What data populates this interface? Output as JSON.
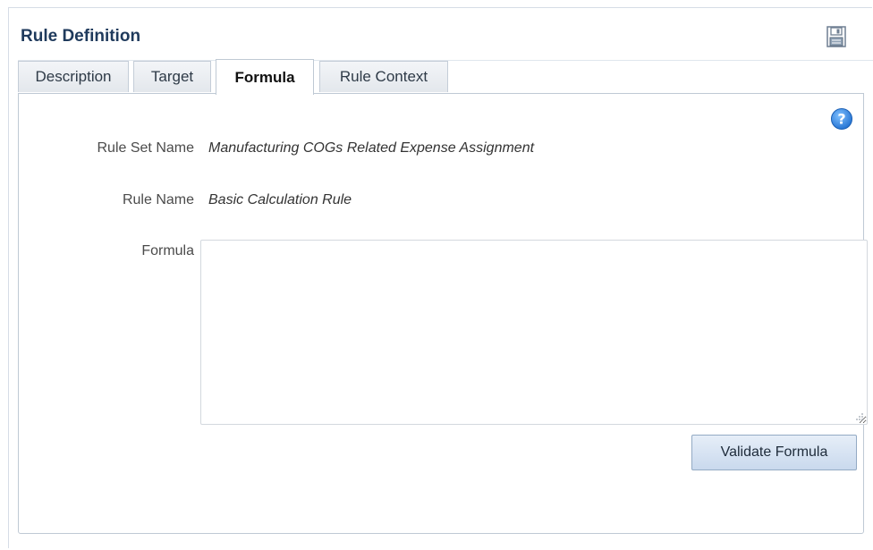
{
  "panel": {
    "title": "Rule Definition",
    "save_icon": "save-icon"
  },
  "tabs": [
    {
      "label": "Description",
      "active": false
    },
    {
      "label": "Target",
      "active": false
    },
    {
      "label": "Formula",
      "active": true
    },
    {
      "label": "Rule Context",
      "active": false
    }
  ],
  "form": {
    "help_icon": "help-icon",
    "rule_set_name_label": "Rule Set Name",
    "rule_set_name_value": "Manufacturing COGs Related Expense Assignment",
    "rule_name_label": "Rule Name",
    "rule_name_value": "Basic Calculation Rule",
    "formula_label": "Formula",
    "formula_value": "",
    "validate_button_label": "Validate Formula"
  },
  "colors": {
    "title": "#1f3a5c",
    "help_icon": "#2f7fd8",
    "button_bg": "#c9d9ed"
  }
}
